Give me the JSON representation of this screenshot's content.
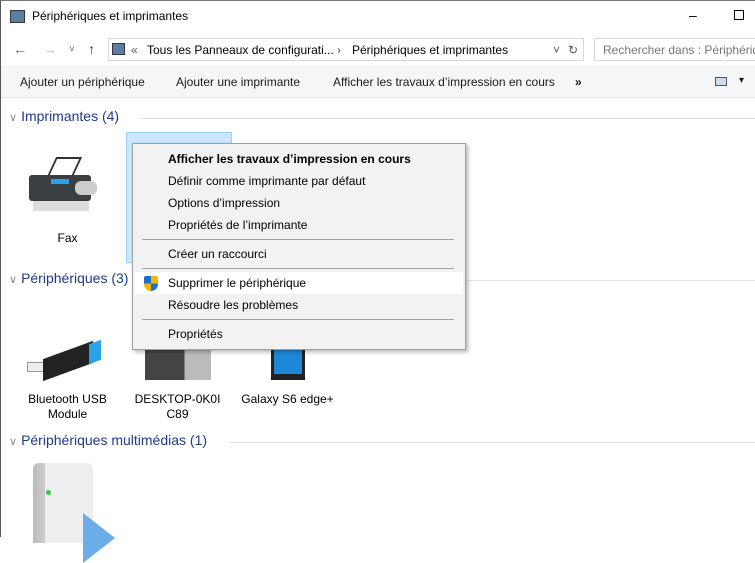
{
  "window": {
    "title": "Périphériques et imprimantes",
    "minimize": "–"
  },
  "address": {
    "back": "←",
    "forward": "→",
    "recent": "˅",
    "up": "↑",
    "overflow": "«",
    "crumbs": [
      "Tous les Panneaux de configurati...",
      "Périphériques et imprimantes"
    ],
    "sep": "›",
    "dropdown": "˅",
    "refresh": "↻",
    "search_placeholder": "Rechercher dans : Périphériques et imprimantes"
  },
  "toolbar": {
    "items": [
      "Ajouter un périphérique",
      "Ajouter une imprimante",
      "Afficher les travaux d’impression en cours"
    ],
    "more": "»",
    "view": "▾"
  },
  "groups": [
    {
      "label": "Imprimantes (4)",
      "items": [
        "Fax"
      ]
    },
    {
      "label": "Périphériques (3)",
      "items": [
        "Bluetooth USB Module",
        "DESKTOP-0K0IC89",
        "Galaxy S6 edge+"
      ]
    },
    {
      "label": "Périphériques multimédias (1)",
      "items": []
    }
  ],
  "context_menu": {
    "items": [
      "Afficher les travaux d’impression en cours",
      "Définir comme imprimante par défaut",
      "Options d’impression",
      "Propriétés de l’imprimante",
      "Créer un raccourci",
      "Supprimer le périphérique",
      "Résoudre les problèmes",
      "Propriétés"
    ],
    "highlighted": "Supprimer le périphérique"
  },
  "colors": {
    "group_header": "#1e3a8a",
    "selection": "#cce8ff",
    "menu_bg": "#f2f2f2"
  }
}
